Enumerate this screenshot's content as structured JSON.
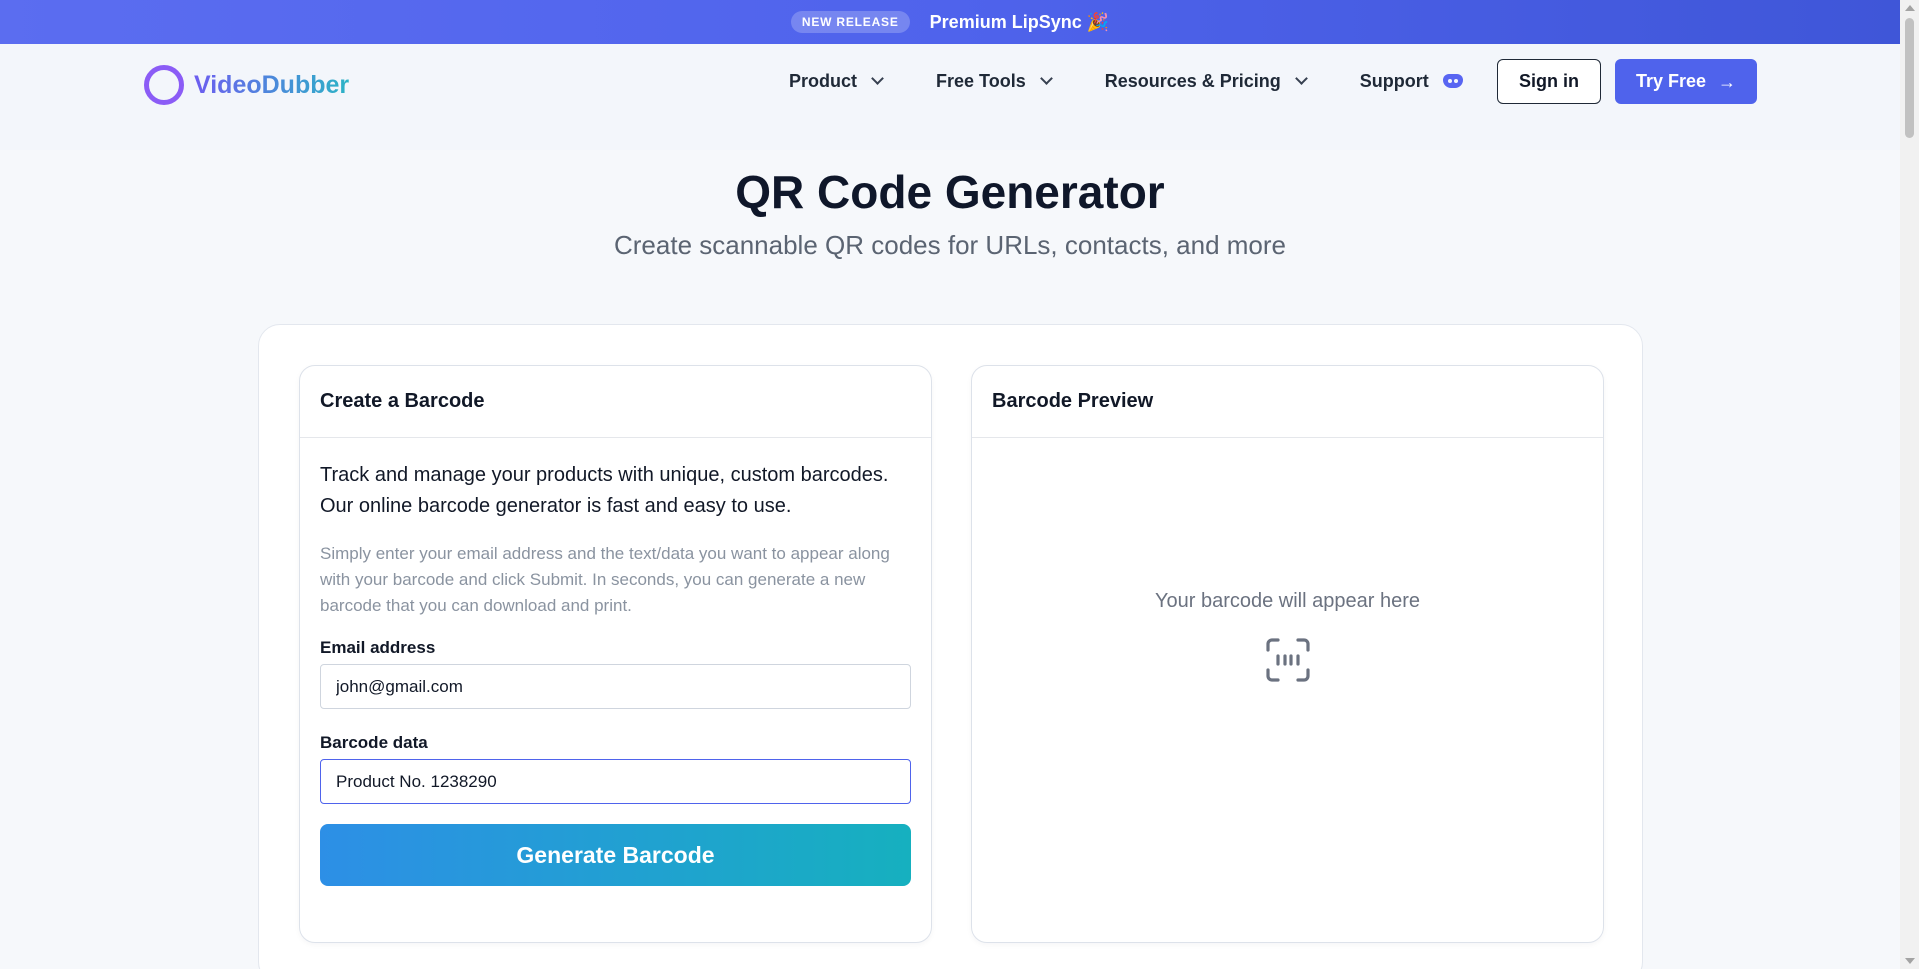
{
  "promo": {
    "badge": "NEW RELEASE",
    "text": "Premium LipSync 🎉"
  },
  "header": {
    "logo_text": "VideoDubber",
    "nav": [
      {
        "label": "Product",
        "icon": "chevron-down-icon"
      },
      {
        "label": "Free Tools",
        "icon": "chevron-down-icon"
      },
      {
        "label": "Resources & Pricing",
        "icon": "chevron-down-icon"
      },
      {
        "label": "Support",
        "icon": "discord-icon"
      }
    ],
    "sign_in_label": "Sign in",
    "try_free_label": "Try Free",
    "try_free_icon": "→"
  },
  "hero": {
    "title": "QR Code Generator",
    "subtitle": "Create scannable QR codes for URLs, contacts, and more"
  },
  "create_panel": {
    "title": "Create a Barcode",
    "lead": "Track and manage your products with unique, custom barcodes. Our online barcode generator is fast and easy to use.",
    "note": "Simply enter your email address and the text/data you want to appear along with your barcode and click Submit. In seconds, you can generate a new barcode that you can download and print.",
    "email_label": "Email address",
    "email_value": "john@gmail.com",
    "barcode_label": "Barcode data",
    "barcode_value": "Product No. 1238290",
    "generate_label": "Generate Barcode"
  },
  "preview_panel": {
    "title": "Barcode Preview",
    "placeholder": "Your barcode will appear here",
    "icon": "scan-barcode-icon"
  },
  "colors": {
    "accent": "#4f63ec",
    "logo_ring": "#8b5cf6",
    "generate_start": "#2d8fe6",
    "generate_end": "#16b0bf"
  }
}
